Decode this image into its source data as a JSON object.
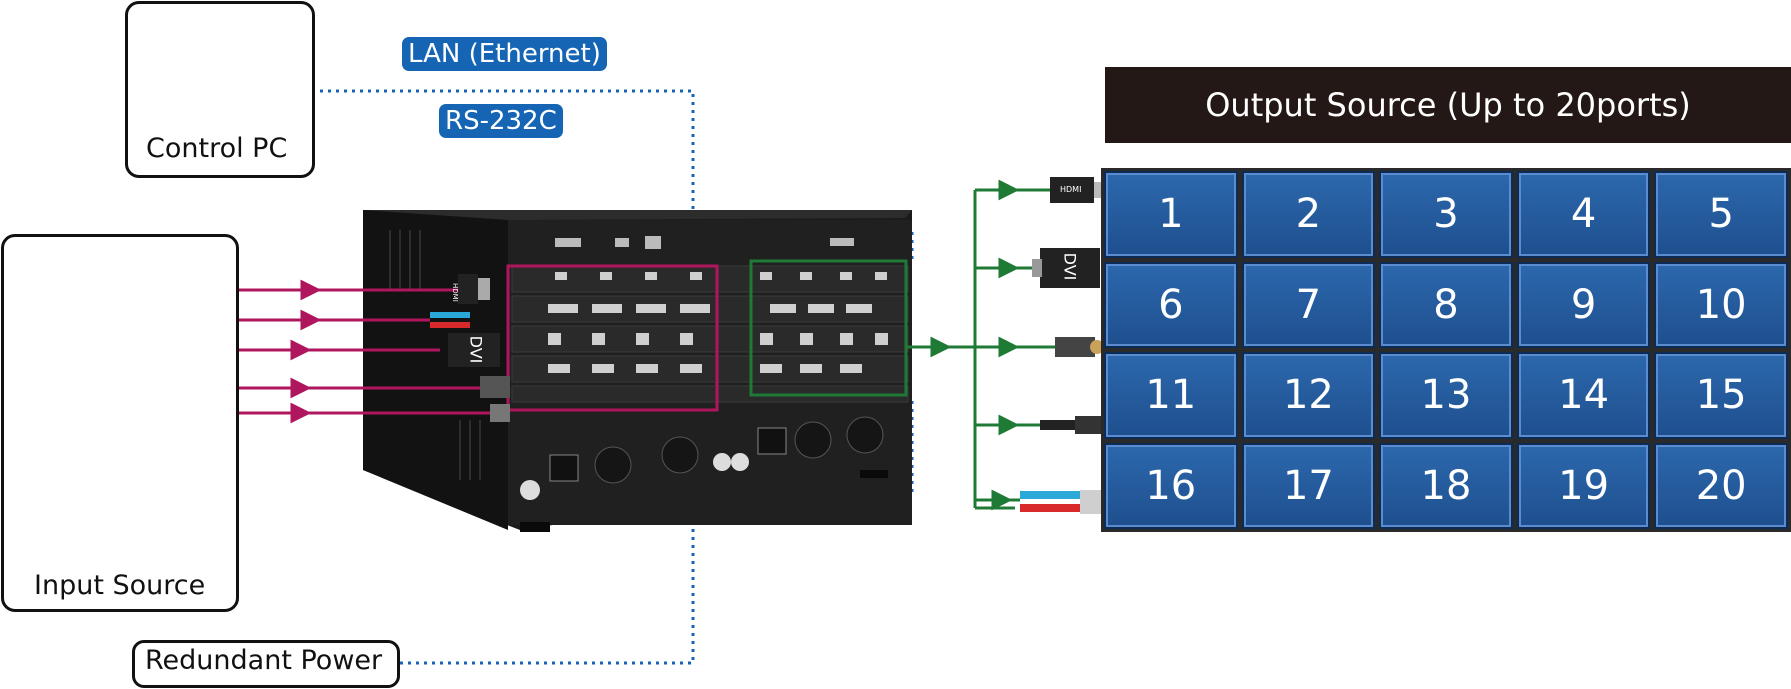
{
  "control_pc": {
    "label": "Control PC"
  },
  "input_source": {
    "label": "Input Source"
  },
  "redundant_power": {
    "label": "Redundant Power"
  },
  "connections": {
    "lan": "LAN (Ethernet)",
    "rs232": "RS-232C"
  },
  "output": {
    "title": "Output Source (Up to 20ports)",
    "ports": [
      "1",
      "2",
      "3",
      "4",
      "5",
      "6",
      "7",
      "8",
      "9",
      "10",
      "11",
      "12",
      "13",
      "14",
      "15",
      "16",
      "17",
      "18",
      "19",
      "20"
    ]
  },
  "connectors": {
    "hdmi": "HDMI",
    "dvi": "DVI"
  },
  "colors": {
    "input_arrow": "#b0165d",
    "output_arrow": "#1f7a35",
    "dotted_link": "#1565b4",
    "pill": "#1565b4",
    "header_bg": "#231815",
    "tile": "#2c68ad"
  }
}
